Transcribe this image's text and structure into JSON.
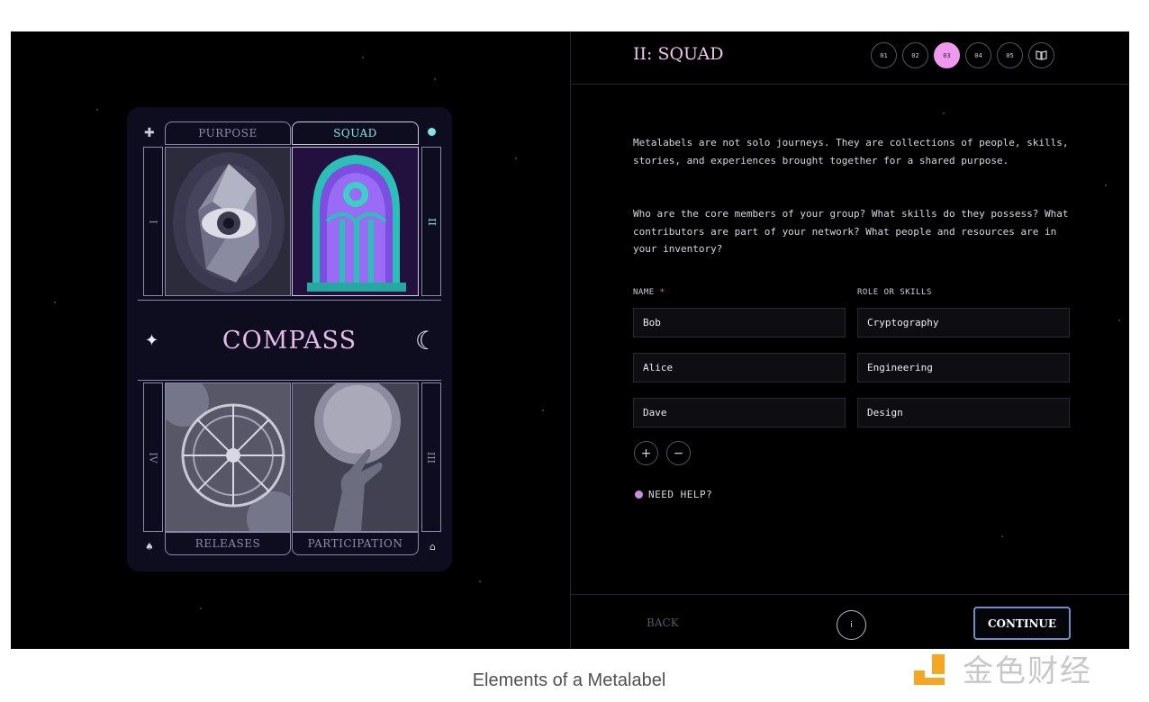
{
  "card": {
    "title": "COMPASS",
    "tabs": {
      "purpose": "PURPOSE",
      "squad": "SQUAD",
      "releases": "RELEASES",
      "participation": "PARTICIPATION"
    },
    "numerals": {
      "left_top": "I",
      "right_top": "II",
      "left_bottom": "IV",
      "right_bottom": "III"
    }
  },
  "panel": {
    "title": "II: SQUAD",
    "steps": [
      "01",
      "02",
      "03",
      "04",
      "05"
    ],
    "active_step": "03",
    "para1": "Metalabels are not solo journeys. They are collections of people, skills, stories, and experiences brought together for a shared purpose.",
    "para2": "Who are the core members of your group? What skills do they possess? What contributors are part of your network? What people and resources are in your inventory?",
    "name_label": "NAME",
    "required_mark": "*",
    "role_label": "ROLE OR SKILLS",
    "members": [
      {
        "name": "Bob",
        "role": "Cryptography"
      },
      {
        "name": "Alice",
        "role": "Engineering"
      },
      {
        "name": "Dave",
        "role": "Design"
      }
    ],
    "add_label": "+",
    "remove_label": "−",
    "help_label": "NEED HELP?",
    "back_label": "BACK",
    "info_label": "i",
    "continue_label": "CONTINUE"
  },
  "caption": "Elements of a Metalabel",
  "watermark": "金色财经",
  "colors": {
    "accent_pink": "#ef98ef",
    "accent_cyan": "#7fe6e6",
    "continue_border": "#6c8fc7",
    "background": "#000000"
  }
}
